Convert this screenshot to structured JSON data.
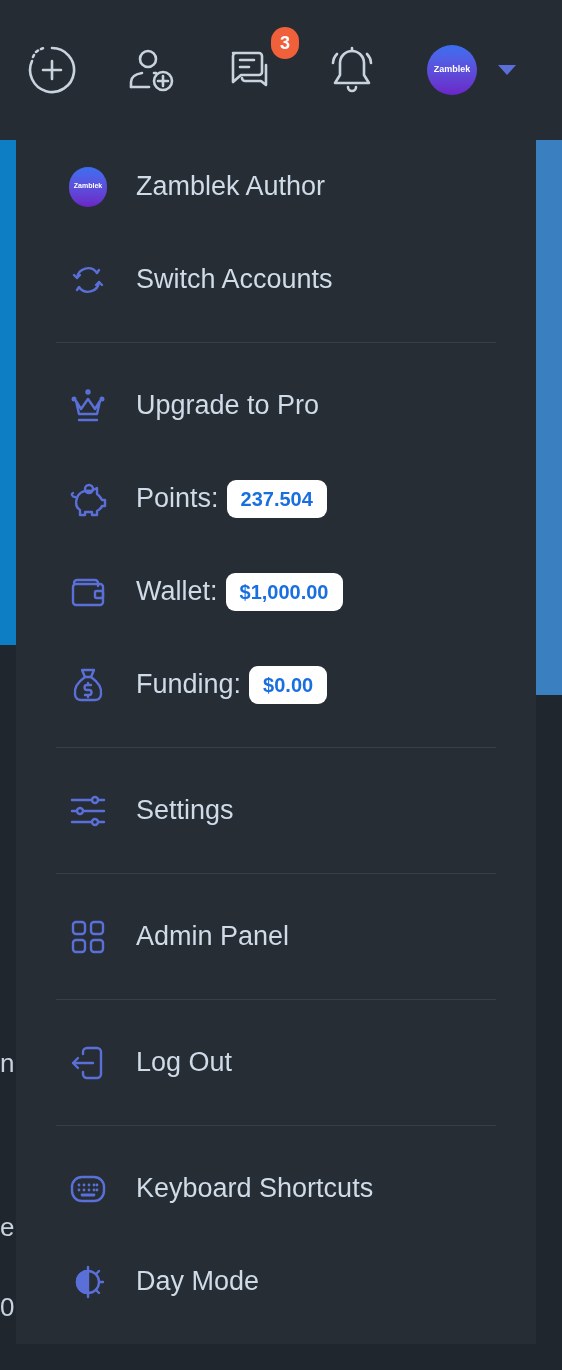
{
  "header": {
    "actions": [
      {
        "kind": "create"
      },
      {
        "kind": "add_user"
      },
      {
        "kind": "messages",
        "badge": "3"
      },
      {
        "kind": "notifications"
      }
    ],
    "avatar": {
      "text": "Zamblek"
    }
  },
  "background": {
    "fragments": [
      "n",
      "e",
      "0"
    ]
  },
  "menu": {
    "groups": [
      {
        "items": [
          {
            "kind": "avatar",
            "avatar_text": "Zamblek",
            "label": "Zamblek Author"
          },
          {
            "kind": "switch",
            "label": "Switch Accounts"
          }
        ]
      },
      {
        "items": [
          {
            "kind": "crown",
            "label": "Upgrade to Pro"
          },
          {
            "kind": "piggy",
            "label": "Points:",
            "badge": "237.504"
          },
          {
            "kind": "wallet",
            "label": "Wallet:",
            "badge": "$1,000.00"
          },
          {
            "kind": "moneybag",
            "label": "Funding:",
            "badge": "$0.00"
          }
        ]
      },
      {
        "items": [
          {
            "kind": "settings",
            "label": "Settings"
          }
        ]
      },
      {
        "items": [
          {
            "kind": "grid",
            "label": "Admin Panel"
          }
        ]
      },
      {
        "items": [
          {
            "kind": "logout",
            "label": "Log Out"
          }
        ]
      },
      {
        "items": [
          {
            "kind": "keyboard",
            "label": "Keyboard Shortcuts"
          },
          {
            "kind": "daymode",
            "label": "Day Mode"
          }
        ]
      }
    ]
  }
}
